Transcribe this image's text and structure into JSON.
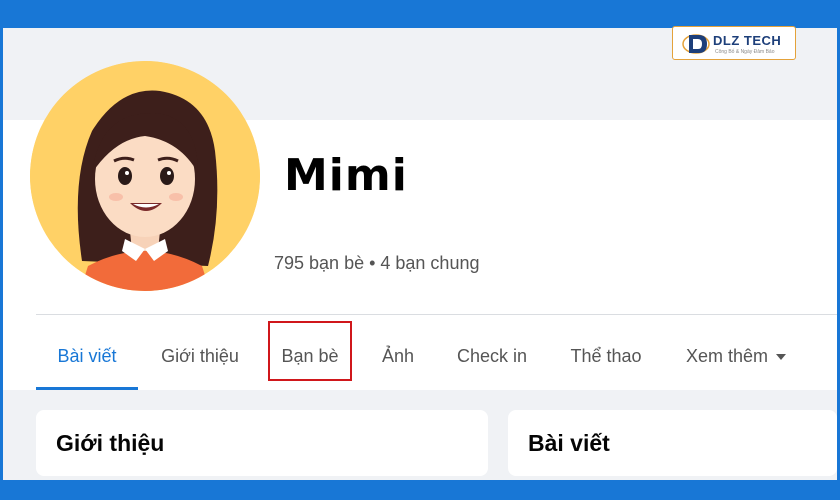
{
  "brand": {
    "logo_text": "DLZ TECH",
    "logo_tagline": "Công Bố & Ngày Đảm Bảo",
    "accent_color": "#1877d6",
    "highlight_color": "#d0171b"
  },
  "profile": {
    "name": "Mimi",
    "friends_summary": "795 bạn bè • 4 bạn chung"
  },
  "tabs": [
    {
      "label": "Bài viết",
      "active": true
    },
    {
      "label": "Giới thiệu",
      "active": false
    },
    {
      "label": "Bạn bè",
      "active": false
    },
    {
      "label": "Ảnh",
      "active": false
    },
    {
      "label": "Check in",
      "active": false
    },
    {
      "label": "Thể thao",
      "active": false
    },
    {
      "label": "Xem thêm",
      "active": false,
      "icon": "caret-down-icon"
    }
  ],
  "cards": {
    "intro_title": "Giới thiệu",
    "posts_title": "Bài viết"
  }
}
